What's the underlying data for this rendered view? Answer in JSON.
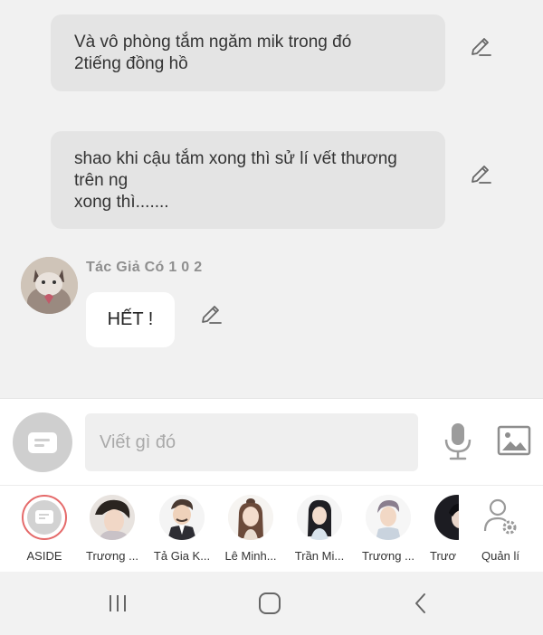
{
  "messages": [
    {
      "lines": [
        "Và vô phòng tắm ngăm mik trong đó",
        "2tiếng đồng hồ"
      ]
    },
    {
      "lines": [
        "shao khi cậu tắm xong thì sử lí vết thương",
        "trên ng",
        "xong thì......."
      ]
    }
  ],
  "author_message": {
    "author": "Tác Giả Có 1 0 2",
    "text": "HẾT !"
  },
  "composer": {
    "placeholder": "Viết gì đó",
    "value": ""
  },
  "characters": [
    {
      "name": "ASIDE",
      "icon": "aside-chat-icon",
      "selected": true
    },
    {
      "name": "Trương ..."
    },
    {
      "name": "Tả Gia K..."
    },
    {
      "name": "Lê Minh..."
    },
    {
      "name": "Trần Mi..."
    },
    {
      "name": "Trương ..."
    },
    {
      "name": "Trươ"
    },
    {
      "name": "Quản lí",
      "icon": "user-settings-icon"
    }
  ],
  "colors": {
    "accent_ring": "#e56a6a",
    "bubble": "#e4e4e4",
    "background": "#f1f1f1"
  },
  "navbar": {
    "icons": [
      "recent-apps-icon",
      "home-icon",
      "back-icon"
    ]
  }
}
